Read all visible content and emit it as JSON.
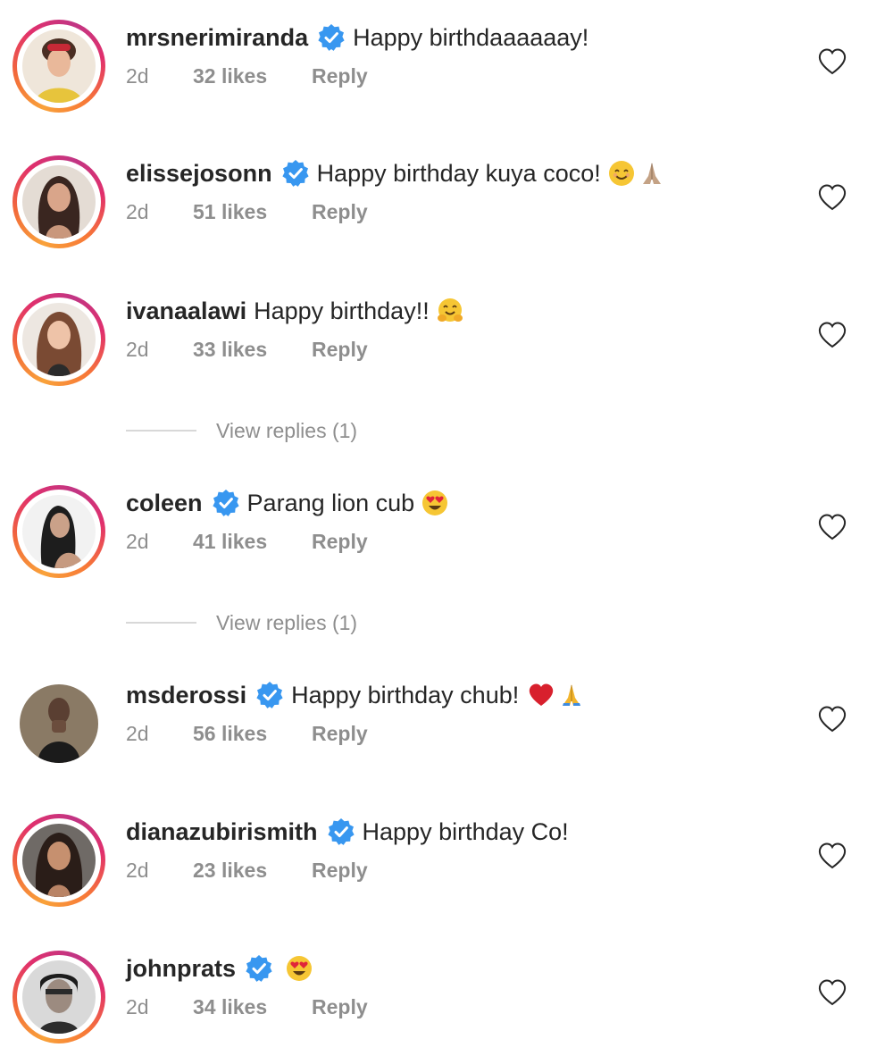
{
  "comments": [
    {
      "username": "mrsnerimiranda",
      "verified": true,
      "text": "Happy birthdaaaaaay!",
      "time": "2d",
      "likes": "32 likes",
      "reply": "Reply",
      "emojis": []
    },
    {
      "username": "elissejosonn",
      "verified": true,
      "text": "Happy birthday kuya coco!",
      "time": "2d",
      "likes": "51 likes",
      "reply": "Reply",
      "emojis": [
        "smiling-face-emoji",
        "folded-hands-emoji"
      ]
    },
    {
      "username": "ivanaalawi",
      "verified": false,
      "text": "Happy birthday!!",
      "time": "2d",
      "likes": "33 likes",
      "reply": "Reply",
      "emojis": [
        "hugging-face-emoji"
      ],
      "view_replies": "View replies (1)"
    },
    {
      "username": "coleen",
      "verified": true,
      "text": "Parang lion cub",
      "time": "2d",
      "likes": "41 likes",
      "reply": "Reply",
      "emojis": [
        "heart-eyes-emoji"
      ],
      "view_replies": "View replies (1)"
    },
    {
      "username": "msderossi",
      "verified": true,
      "text": "Happy birthday chub!",
      "time": "2d",
      "likes": "56 likes",
      "reply": "Reply",
      "emojis": [
        "red-heart-emoji",
        "folded-hands-emoji"
      ]
    },
    {
      "username": "dianazubirismith",
      "verified": true,
      "text": "Happy birthday Co!",
      "time": "2d",
      "likes": "23 likes",
      "reply": "Reply",
      "emojis": []
    },
    {
      "username": "johnprats",
      "verified": true,
      "text": "",
      "time": "2d",
      "likes": "34 likes",
      "reply": "Reply",
      "emojis": [
        "heart-eyes-emoji"
      ]
    }
  ],
  "colors": {
    "verified_blue": "#3897f0",
    "muted_text": "#8e8e8e",
    "primary_text": "#262626",
    "story_ring": [
      "#f9a23a",
      "#e1306c",
      "#c13584"
    ]
  }
}
